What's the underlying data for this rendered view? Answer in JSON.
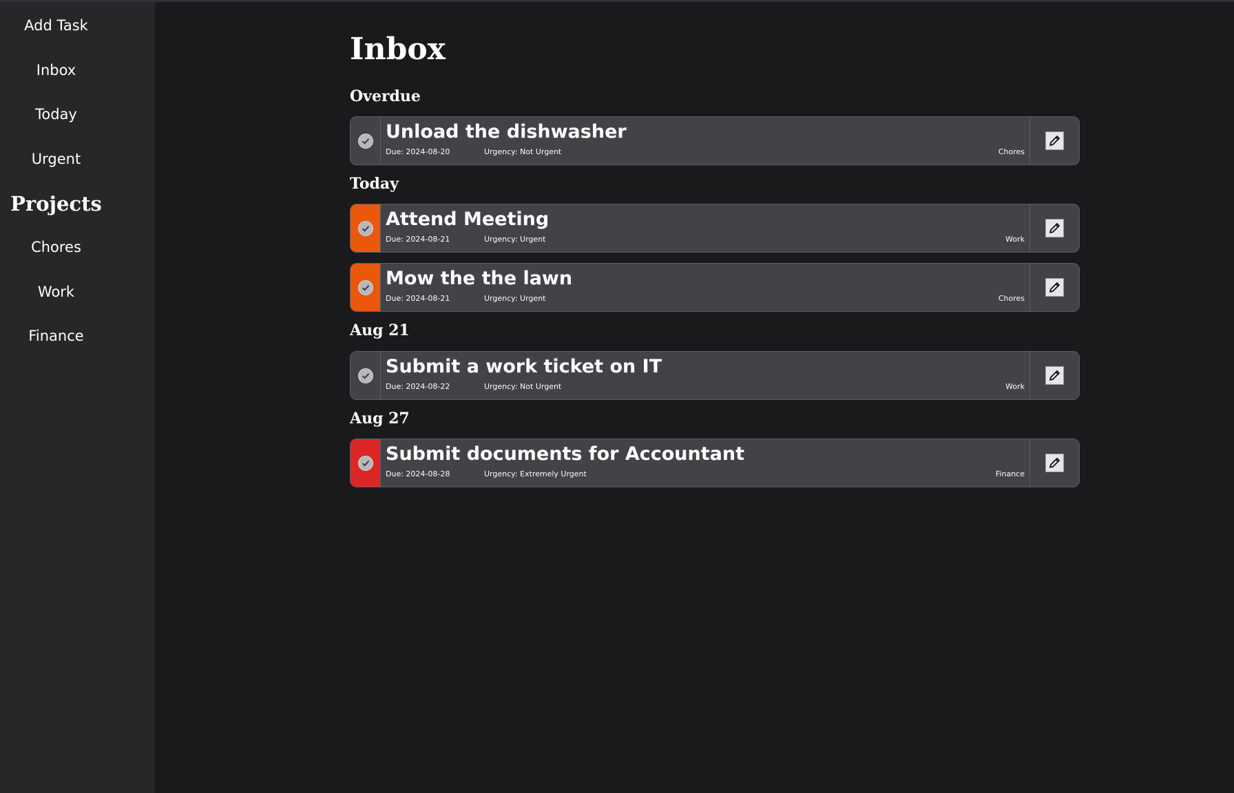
{
  "sidebar": {
    "items": [
      {
        "label": "Add Task"
      },
      {
        "label": "Inbox"
      },
      {
        "label": "Today"
      },
      {
        "label": "Urgent"
      }
    ],
    "projects_heading": "Projects",
    "projects": [
      {
        "label": "Chores"
      },
      {
        "label": "Work"
      },
      {
        "label": "Finance"
      }
    ]
  },
  "main": {
    "title": "Inbox",
    "sections": [
      {
        "heading": "Overdue",
        "tasks": [
          {
            "title": "Unload the dishwasher",
            "due": "Due: 2024-08-20",
            "urgency": "Urgency: Not Urgent",
            "project": "Chores",
            "urgency_color": "#424247"
          }
        ]
      },
      {
        "heading": "Today",
        "tasks": [
          {
            "title": "Attend Meeting",
            "due": "Due: 2024-08-21",
            "urgency": "Urgency: Urgent",
            "project": "Work",
            "urgency_color": "#ea580c"
          },
          {
            "title": "Mow the the lawn",
            "due": "Due: 2024-08-21",
            "urgency": "Urgency: Urgent",
            "project": "Chores",
            "urgency_color": "#ea580c"
          }
        ]
      },
      {
        "heading": "Aug 21",
        "tasks": [
          {
            "title": "Submit a work ticket on IT",
            "due": "Due: 2024-08-22",
            "urgency": "Urgency: Not Urgent",
            "project": "Work",
            "urgency_color": "#424247"
          }
        ]
      },
      {
        "heading": "Aug 27",
        "tasks": [
          {
            "title": "Submit documents for Accountant",
            "due": "Due: 2024-08-28",
            "urgency": "Urgency: Extremely Urgent",
            "project": "Finance",
            "urgency_color": "#dc2626"
          }
        ]
      }
    ]
  },
  "icons": {
    "complete": "check-circle-icon",
    "edit": "pencil-icon"
  },
  "colors": {
    "background": "#1a1a1c",
    "sidebar": "#27272a",
    "card": "#424247",
    "urgent": "#ea580c",
    "extremely_urgent": "#dc2626"
  }
}
